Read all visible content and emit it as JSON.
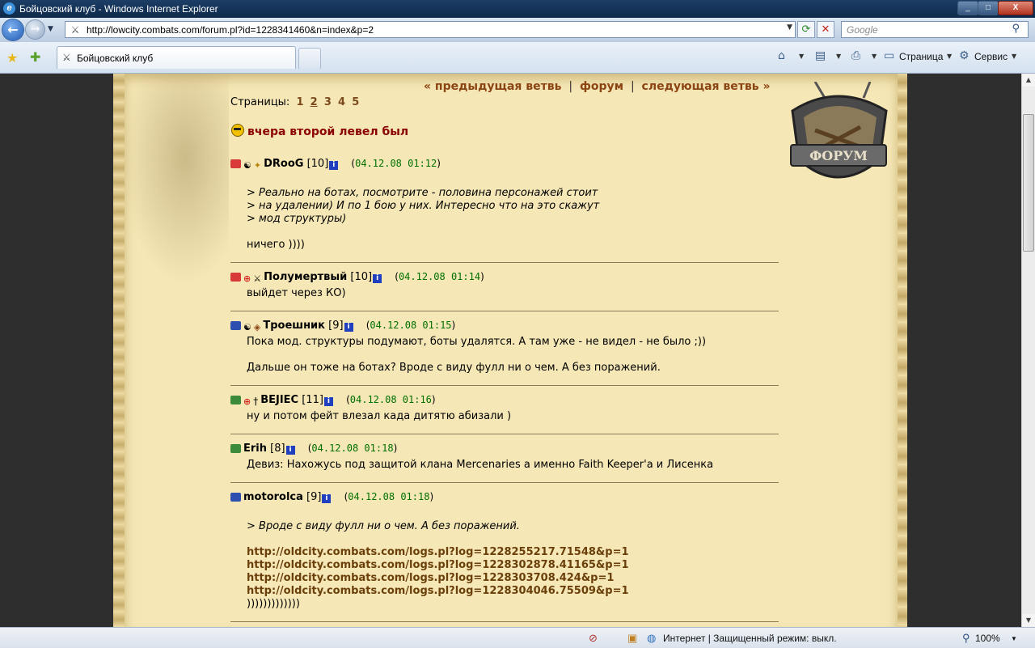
{
  "window": {
    "title": "Бойцовский клуб - Windows Internet Explorer",
    "minimize_label": "_",
    "maximize_label": "□",
    "close_label": "X"
  },
  "address_bar": {
    "url": "http://lowcity.combats.com/forum.pl?id=1228341460&n=index&p=2",
    "search_placeholder": "Google"
  },
  "tabs": [
    {
      "label": "Бойцовский клуб",
      "active": true
    }
  ],
  "toolbar": {
    "page_label": "Страница",
    "tools_label": "Сервис"
  },
  "forum": {
    "nav": {
      "prev": "« предыдущая ветвь",
      "sep": "|",
      "forum": "форум",
      "next": "следующая ветвь »"
    },
    "pages_label": "Страницы:",
    "pages": [
      "1",
      "2",
      "3",
      "4",
      "5"
    ],
    "current_page": "2",
    "emblem_text": "ФОРУМ",
    "thread_title": "вчера второй левел был",
    "posts": [
      {
        "nick": "DRooG",
        "level": "[10]",
        "time": "04.12.08 01:12",
        "quote_lines": [
          "> Реально на ботах, посмотрите - половина персонажей стоит",
          "> на удалении) И по 1 бою у них. Интересно что на это скажут",
          "> мод структуры)"
        ],
        "text_lines": [
          "ничего ))))"
        ]
      },
      {
        "nick": "Полумертвый",
        "level": "[10]",
        "time": "04.12.08 01:14",
        "text_lines": [
          "выйдет через КО)"
        ]
      },
      {
        "nick": "Троешник",
        "level": "[9]",
        "time": "04.12.08 01:15",
        "text_lines": [
          "Пока мод. структуры подумают, боты удалятся. А там уже - не видел - не было ;))",
          "Дальше он тоже на ботах? Вроде с виду фулл ни о чем. А без поражений."
        ]
      },
      {
        "nick": "BEJIEC",
        "level": "[11]",
        "time": "04.12.08 01:16",
        "text_lines": [
          "ну и потом фейт влезал када дитятю абизали )"
        ]
      },
      {
        "nick": "Erih",
        "level": "[8]",
        "time": "04.12.08 01:18",
        "text_lines": [
          "Девиз: Нахожусь под защитой клана Mercenaries а именно Faith Keeper'a и Лисенка"
        ]
      },
      {
        "nick": "motorolca",
        "level": "[9]",
        "time": "04.12.08 01:18",
        "quote_lines": [
          "> Вроде с виду фулл ни о чем. А без поражений."
        ],
        "log_lines": [
          "http://oldcity.combats.com/logs.pl?log=1228255217.71548&p=1",
          "http://oldcity.combats.com/logs.pl?log=1228302878.41165&p=1",
          "http://oldcity.combats.com/logs.pl?log=1228303708.424&p=1",
          "http://oldcity.combats.com/logs.pl?log=1228304046.75509&p=1"
        ],
        "text_lines": [
          ")))))))))))))"
        ]
      }
    ]
  },
  "status_bar": {
    "zone": "Интернет | Защищенный режим: выкл.",
    "zoom": "100%"
  },
  "colors": {
    "parchment": "#f5e7b6",
    "nav_link": "#8b4513",
    "thread_title": "#8b0000",
    "time": "#007000",
    "log_link": "#6b3f0a"
  }
}
